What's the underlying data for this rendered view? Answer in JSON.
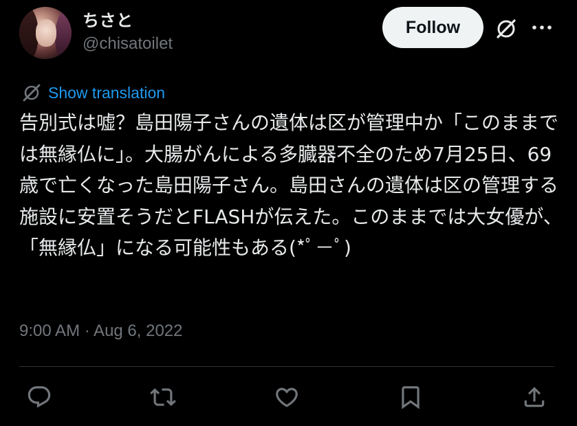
{
  "author": {
    "display_name": "ちさと",
    "handle": "@chisatoilet",
    "avatar_icon": "profile-photo"
  },
  "header": {
    "follow_label": "Follow",
    "grok_icon": "grok-icon",
    "more_icon": "more-icon"
  },
  "translation": {
    "icon": "translate-icon",
    "label": "Show translation"
  },
  "tweet": {
    "text": "告別式は嘘？島田陽子さんの遺体は区が管理中か「このままでは無縁仏に」。大腸がんによる多臓器不全のため7月25日、69歳で亡くなった島田陽子さん。島田さんの遺体は区の管理する施設に安置そうだとFLASHが伝えた。このままでは大女優が、「無縁仏」になる可能性もある(*ﾟ－ﾟ)",
    "timestamp": "9:00 AM · Aug 6, 2022"
  },
  "actions": {
    "reply_icon": "reply-icon",
    "retweet_icon": "retweet-icon",
    "like_icon": "heart-icon",
    "bookmark_icon": "bookmark-icon",
    "share_icon": "share-icon"
  },
  "colors": {
    "background": "#000000",
    "text_primary": "#e7e9ea",
    "text_secondary": "#71767b",
    "link": "#1d9bf0",
    "follow_bg": "#eff3f4",
    "divider": "#2f3336"
  }
}
